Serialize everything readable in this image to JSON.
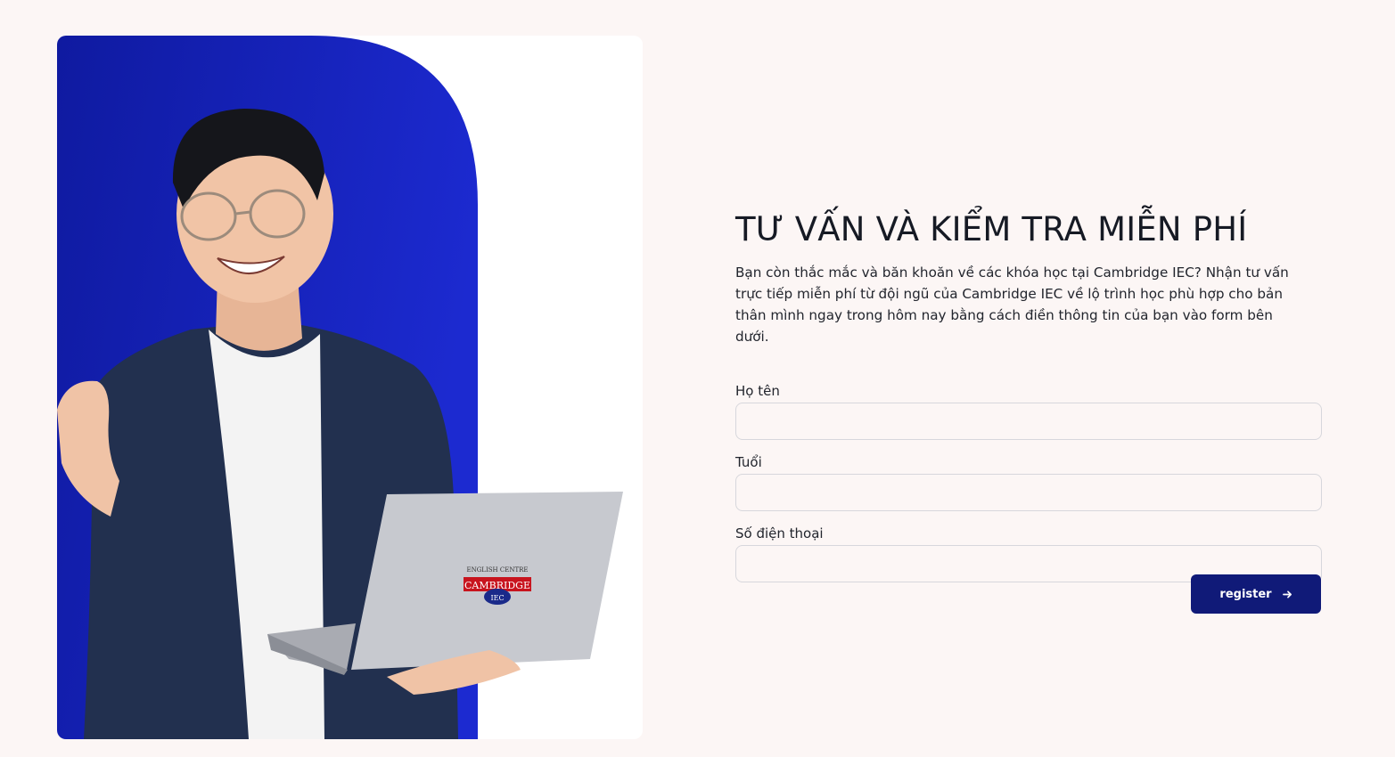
{
  "hero": {
    "image_alt": "Young man with glasses holding a laptop with the Cambridge IEC logo",
    "logo": {
      "line1": "ENGLISH CENTRE",
      "line2": "CAMBRIDGE",
      "line3": "IEC"
    },
    "colors": {
      "accent_blue": "#1a27c6",
      "card_bg": "#ffffff"
    }
  },
  "form": {
    "title": "TƯ VẤN VÀ KIỂM TRA MIỄN PHÍ",
    "intro": "Bạn còn thắc mắc và băn khoăn về các khóa học tại Cambridge IEC? Nhận tư vấn trực tiếp miễn phí từ đội ngũ của Cambridge IEC về lộ trình học phù hợp cho bản thân mình ngay trong hôm nay bằng cách điền thông tin của bạn vào form bên dưới.",
    "fields": {
      "name": {
        "label": "Họ tên",
        "value": "",
        "placeholder": ""
      },
      "age": {
        "label": "Tuổi",
        "value": "",
        "placeholder": ""
      },
      "phone": {
        "label": "Số điện thoại",
        "value": "",
        "placeholder": ""
      }
    },
    "submit_label": "register",
    "submit_icon": "arrow-right-icon"
  },
  "colors": {
    "page_bg": "#fcf6f5",
    "button_bg": "#101a78",
    "input_border": "#d7d7dc"
  }
}
